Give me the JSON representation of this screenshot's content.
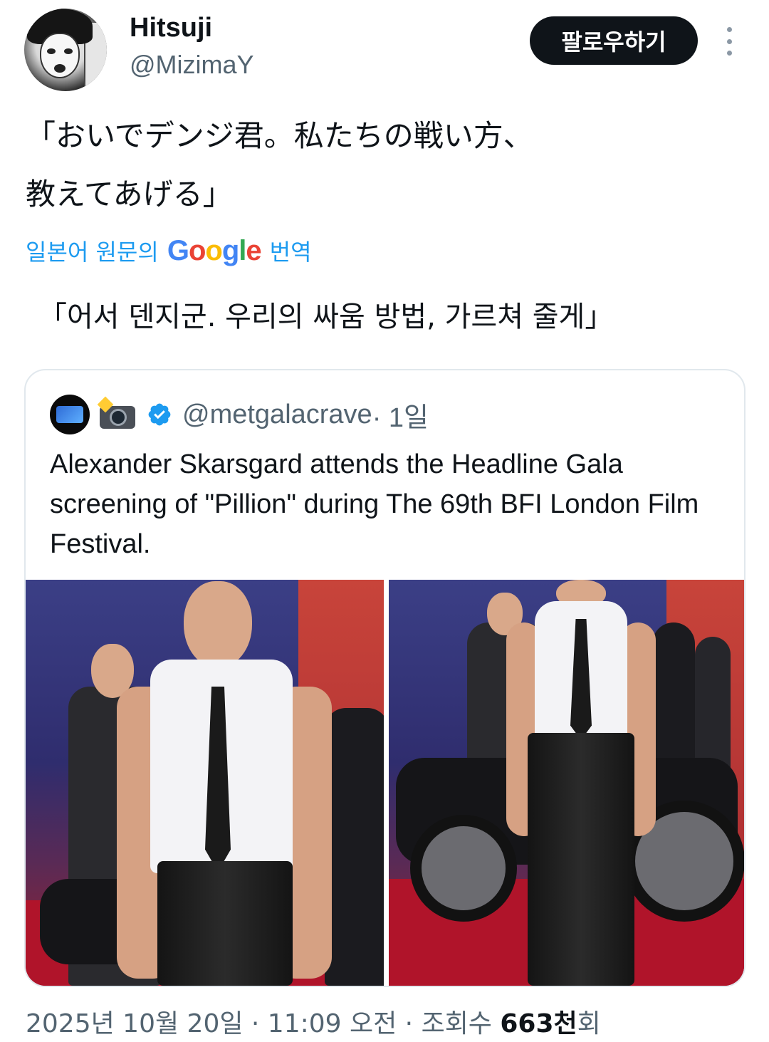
{
  "author": {
    "name": "Hitsuji",
    "handle": "@MizimaY",
    "follow_label": "팔로우하기"
  },
  "tweet": {
    "line1": "「おいでデンジ君。私たちの戦い方、",
    "line2": "教えてあげる」",
    "translate_prefix": "일본어 원문의",
    "translate_brand": "Google",
    "translate_suffix": "번역",
    "translated_text": "「어서 덴지군. 우리의 싸움 방법, 가르쳐 줄게」"
  },
  "quoted": {
    "handle": "@metgalacrave",
    "time": " · 1일",
    "text": "Alexander Skarsgard attends the Headline Gala screening of \"Pillion\" during The 69th BFI London Film Festival.",
    "avatar_icon": "metgala-logo-avatar",
    "emoji_icon": "camera-with-flash-icon",
    "verified_color": "#1d9bf0"
  },
  "meta": {
    "datetime": "2025년 10월 20일 · 11:09 오전 · 조회수 ",
    "views": "663천",
    "views_suffix": "회"
  },
  "colors": {
    "accent": "#1d9bf0",
    "text": "#0f1419",
    "secondary": "#536471"
  }
}
